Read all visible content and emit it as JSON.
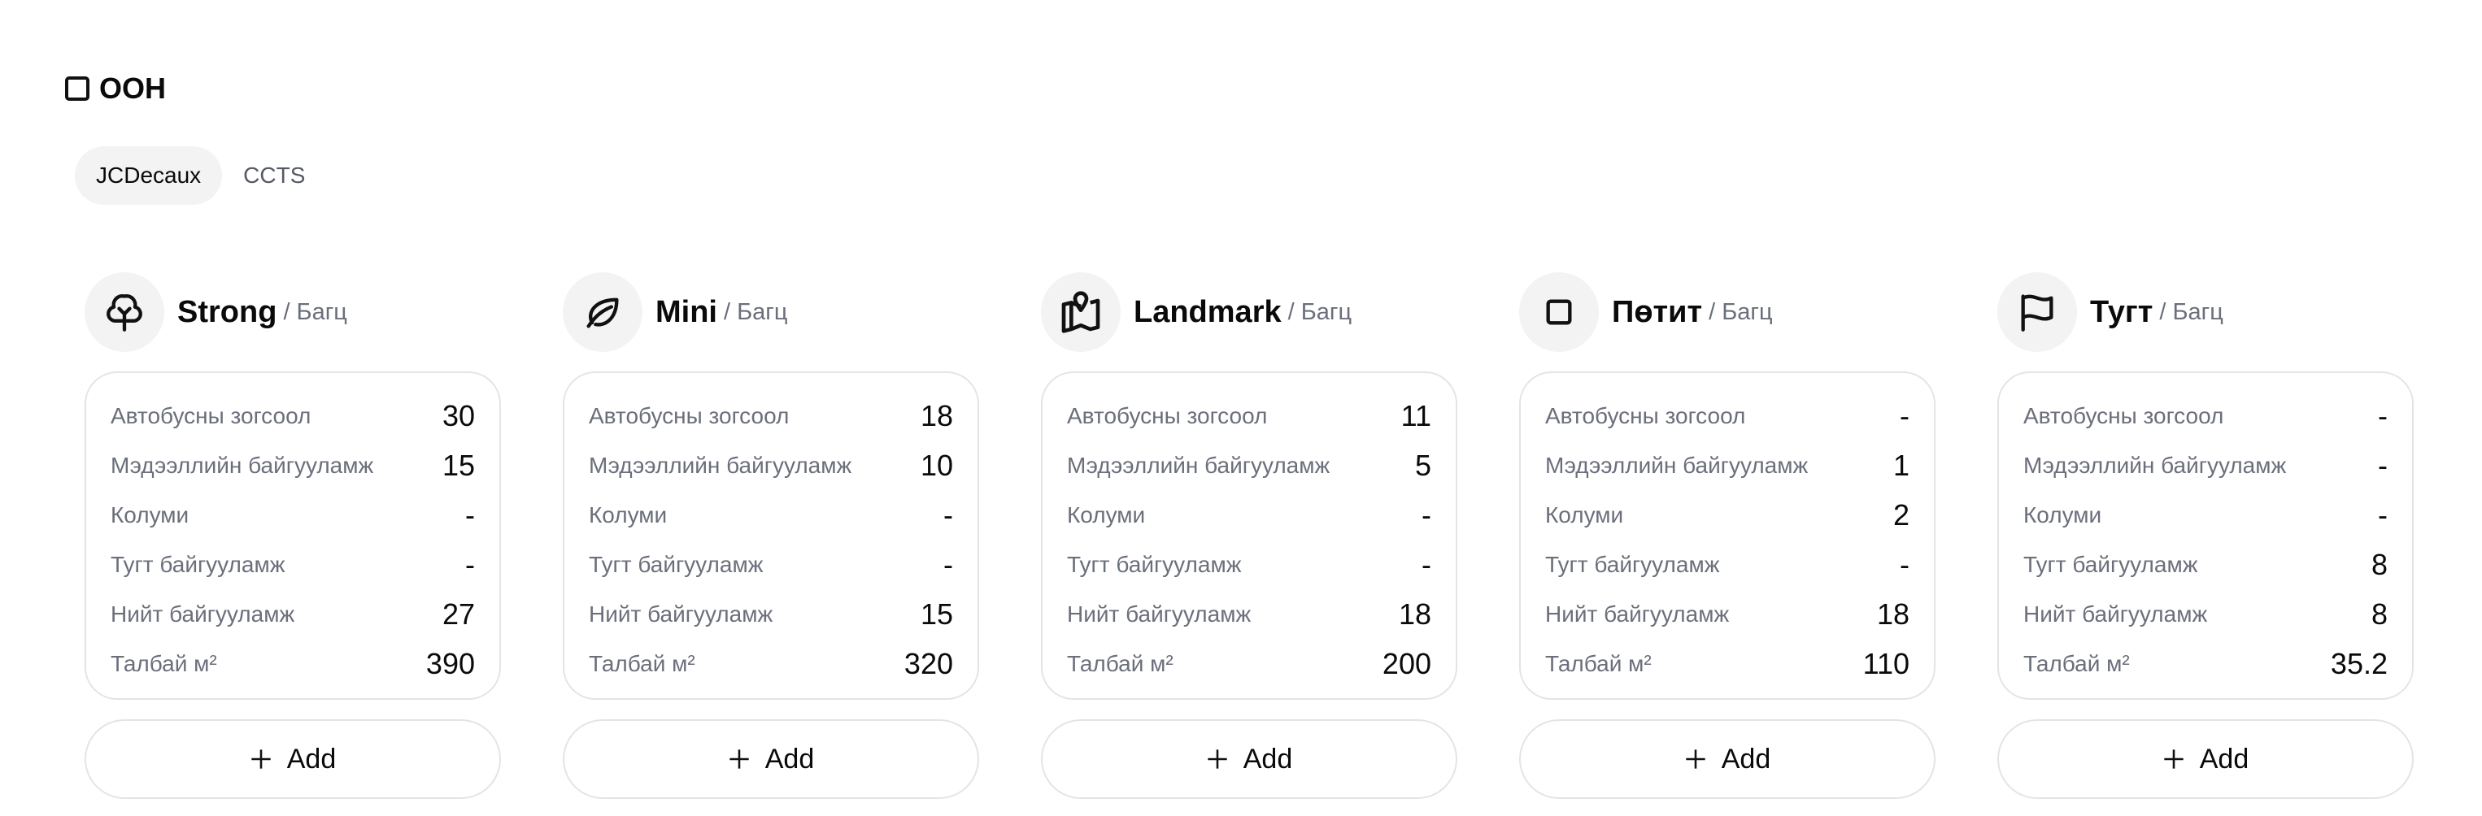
{
  "section": {
    "title": "OOH",
    "icon": "square-icon"
  },
  "tabs": [
    {
      "label": "JCDecaux",
      "active": true
    },
    {
      "label": "CCTS",
      "active": false
    }
  ],
  "row_labels": [
    "Автобусны зогсоол",
    "Мэдээллийн байгууламж",
    "Колуми",
    "Тугт байгууламж",
    "Нийт байгууламж",
    "Талбай м²"
  ],
  "add_label": "Add",
  "cards": [
    {
      "name": "Strong",
      "sub": "/ Багц",
      "icon": "tree-icon",
      "values": [
        "30",
        "15",
        "-",
        "-",
        "27",
        "390"
      ]
    },
    {
      "name": "Mini",
      "sub": "/ Багц",
      "icon": "leaf-icon",
      "values": [
        "18",
        "10",
        "-",
        "-",
        "15",
        "320"
      ]
    },
    {
      "name": "Landmark",
      "sub": "/ Багц",
      "icon": "map-pin-icon",
      "values": [
        "11",
        "5",
        "-",
        "-",
        "18",
        "200"
      ]
    },
    {
      "name": "Пөтит",
      "sub": "/ Багц",
      "icon": "square-icon",
      "values": [
        "-",
        "1",
        "2",
        "-",
        "18",
        "110"
      ]
    },
    {
      "name": "Тугт",
      "sub": "/ Багц",
      "icon": "flag-icon",
      "values": [
        "-",
        "-",
        "-",
        "8",
        "8",
        "35.2"
      ]
    }
  ]
}
